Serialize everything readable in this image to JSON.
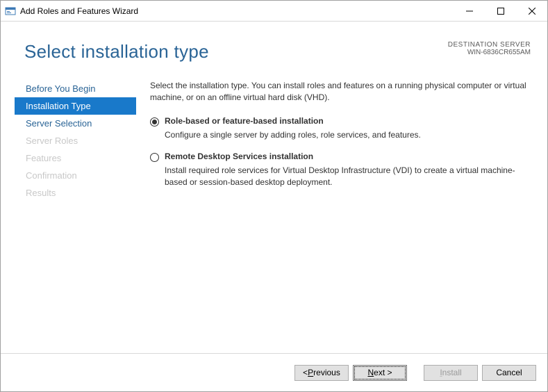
{
  "window": {
    "title": "Add Roles and Features Wizard"
  },
  "header": {
    "page_title": "Select installation type",
    "dest_label": "DESTINATION SERVER",
    "dest_value": "WIN-6836CR655AM"
  },
  "sidebar": {
    "items": [
      {
        "label": "Before You Begin",
        "state": "enabled"
      },
      {
        "label": "Installation Type",
        "state": "active"
      },
      {
        "label": "Server Selection",
        "state": "enabled"
      },
      {
        "label": "Server Roles",
        "state": "disabled"
      },
      {
        "label": "Features",
        "state": "disabled"
      },
      {
        "label": "Confirmation",
        "state": "disabled"
      },
      {
        "label": "Results",
        "state": "disabled"
      }
    ]
  },
  "content": {
    "intro": "Select the installation type. You can install roles and features on a running physical computer or virtual machine, or on an offline virtual hard disk (VHD).",
    "option1_title": "Role-based or feature-based installation",
    "option1_desc": "Configure a single server by adding roles, role services, and features.",
    "option2_title": "Remote Desktop Services installation",
    "option2_desc": "Install required role services for Virtual Desktop Infrastructure (VDI) to create a virtual machine-based or session-based desktop deployment.",
    "selected_index": 0
  },
  "footer": {
    "previous": "Previous",
    "next": "Next >",
    "install": "Install",
    "cancel": "Cancel"
  }
}
